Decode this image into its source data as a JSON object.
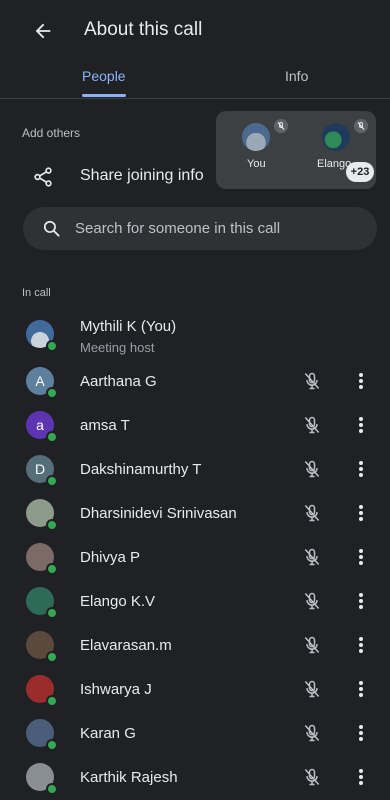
{
  "header": {
    "title": "About this call",
    "back_icon": "arrow-left-icon"
  },
  "tabs": [
    {
      "label": "People",
      "active": true
    },
    {
      "label": "Info",
      "active": false
    }
  ],
  "add_others": {
    "label": "Add others",
    "share": {
      "label": "Share joining info",
      "icon": "share-icon"
    }
  },
  "preview": {
    "tiles": [
      {
        "label": "You",
        "muted": true
      },
      {
        "label": "Elango",
        "muted": true
      }
    ],
    "more_count": "+23"
  },
  "search": {
    "placeholder": "Search for someone in this call",
    "value": ""
  },
  "in_call": {
    "label": "In call",
    "host": {
      "name": "Mythili K (You)",
      "role": "Meeting host"
    },
    "participants": [
      {
        "name": "Aarthana G",
        "initial": "A",
        "avatar_color": "#5f7f9e"
      },
      {
        "name": "amsa T",
        "initial": "a",
        "avatar_color": "#5e35b1"
      },
      {
        "name": "Dakshinamurthy T",
        "initial": "D",
        "avatar_color": "#546e7a"
      },
      {
        "name": "Dharsinidevi Srinivasan",
        "initial": "",
        "avatar_color": "#8d9b8a"
      },
      {
        "name": "Dhivya P",
        "initial": "",
        "avatar_color": "#7b6a66"
      },
      {
        "name": "Elango K.V",
        "initial": "",
        "avatar_color": "#2e6b57"
      },
      {
        "name": "Elavarasan.m",
        "initial": "",
        "avatar_color": "#5b4a3c"
      },
      {
        "name": "Ishwarya J",
        "initial": "",
        "avatar_color": "#9b2c2c"
      },
      {
        "name": "Karan G",
        "initial": "",
        "avatar_color": "#4a5d7a"
      },
      {
        "name": "Karthik Rajesh",
        "initial": "",
        "avatar_color": "#8a8f96"
      }
    ]
  },
  "colors": {
    "background": "#202124",
    "accent": "#8ab4f8",
    "online": "#34a853",
    "text": "#e8eaed",
    "muted_text": "#9aa0a6"
  }
}
